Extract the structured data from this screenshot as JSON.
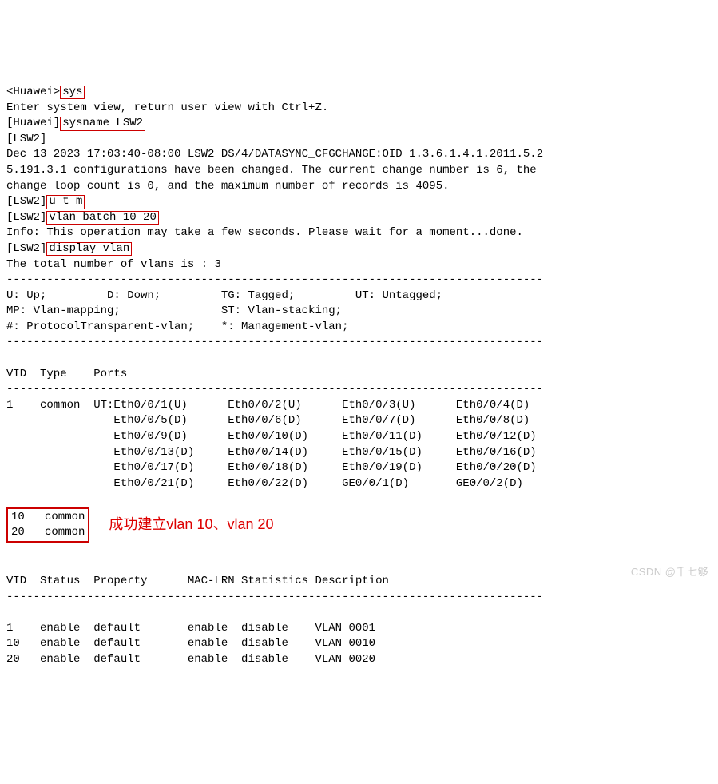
{
  "cli": {
    "prompt0_pre": "<Huawei>",
    "cmd_sys": "sys",
    "line_enter": "Enter system view, return user view with Ctrl+Z.",
    "prompt1_pre": "[Huawei]",
    "cmd_sysname": "sysname LSW2",
    "prompt_lsw2_empty": "[LSW2]",
    "log_line1": "Dec 13 2023 17:03:40-08:00 LSW2 DS/4/DATASYNC_CFGCHANGE:OID 1.3.6.1.4.1.2011.5.2",
    "log_line2": "5.191.3.1 configurations have been changed. The current change number is 6, the",
    "log_line3": "change loop count is 0, and the maximum number of records is 4095.",
    "prompt2_pre": "[LSW2]",
    "cmd_utm": "u t m",
    "prompt3_pre": "[LSW2]",
    "cmd_vlan": "vlan batch 10 20",
    "info_wait": "Info: This operation may take a few seconds. Please wait for a moment...done.",
    "prompt4_pre": "[LSW2]",
    "cmd_disp": "display vlan",
    "line_total": "The total number of vlans is : 3",
    "dash_line": "--------------------------------------------------------------------------------",
    "legend1": "U: Up;         D: Down;         TG: Tagged;         UT: Untagged;",
    "legend2": "MP: Vlan-mapping;               ST: Vlan-stacking;",
    "legend3": "#: ProtocolTransparent-vlan;    *: Management-vlan;",
    "ports_header": "VID  Type    Ports",
    "ports1": "1    common  UT:Eth0/0/1(U)      Eth0/0/2(U)      Eth0/0/3(U)      Eth0/0/4(D)",
    "ports2": "                Eth0/0/5(D)      Eth0/0/6(D)      Eth0/0/7(D)      Eth0/0/8(D)",
    "ports3": "                Eth0/0/9(D)      Eth0/0/10(D)     Eth0/0/11(D)     Eth0/0/12(D)",
    "ports4": "                Eth0/0/13(D)     Eth0/0/14(D)     Eth0/0/15(D)     Eth0/0/16(D)",
    "ports5": "                Eth0/0/17(D)     Eth0/0/18(D)     Eth0/0/19(D)     Eth0/0/20(D)",
    "ports6": "                Eth0/0/21(D)     Eth0/0/22(D)     GE0/0/1(D)       GE0/0/2(D)",
    "vlan10": "10   common",
    "vlan20": "20   common",
    "red_annotation": "成功建立vlan 10、vlan 20",
    "status_header": "VID  Status  Property      MAC-LRN Statistics Description",
    "status1": "1    enable  default       enable  disable    VLAN 0001",
    "status2": "10   enable  default       enable  disable    VLAN 0010",
    "status3": "20   enable  default       enable  disable    VLAN 0020"
  },
  "watermark": "CSDN @千七够"
}
